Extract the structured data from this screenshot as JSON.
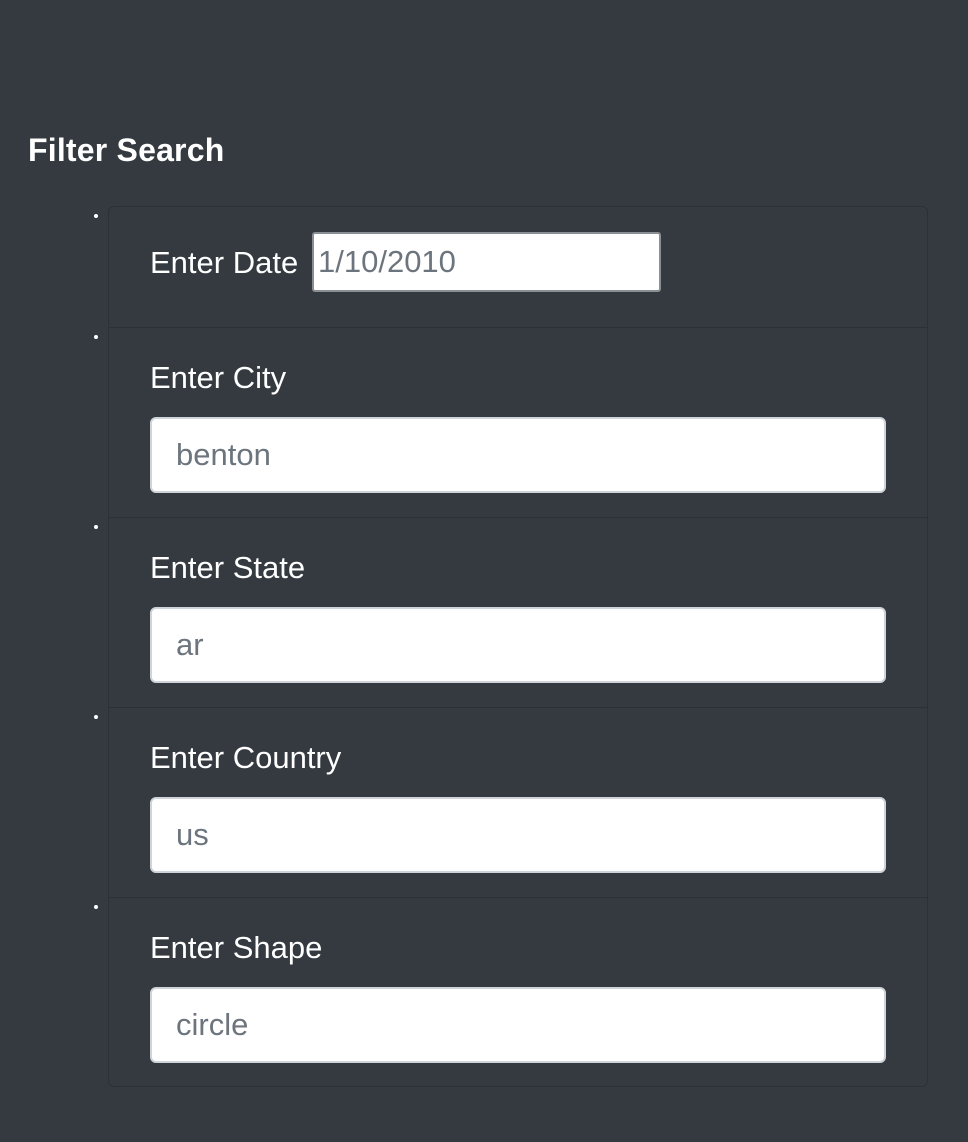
{
  "page": {
    "title": "Filter Search"
  },
  "filters": {
    "date": {
      "label": "Enter Date",
      "placeholder": "1/10/2010"
    },
    "city": {
      "label": "Enter City",
      "placeholder": "benton"
    },
    "state": {
      "label": "Enter State",
      "placeholder": "ar"
    },
    "country": {
      "label": "Enter Country",
      "placeholder": "us"
    },
    "shape": {
      "label": "Enter Shape",
      "placeholder": "circle"
    }
  },
  "colors": {
    "background": "#343a40",
    "text": "#ffffff",
    "input_text": "#6c757d"
  }
}
